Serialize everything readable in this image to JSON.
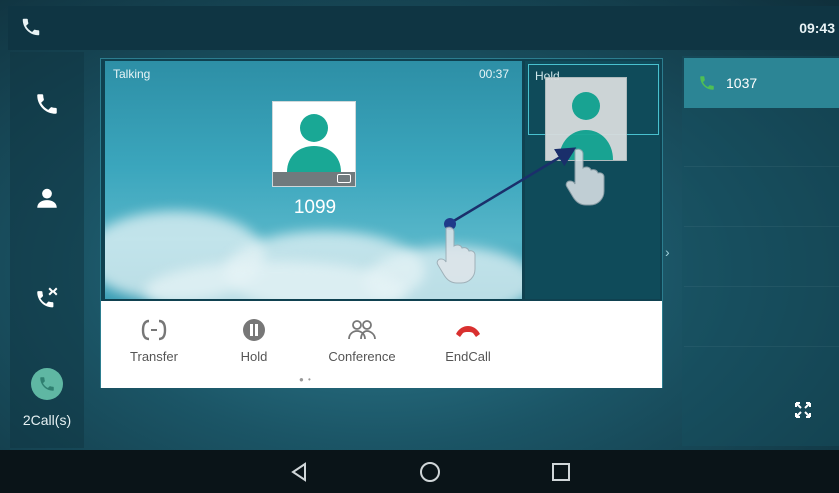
{
  "status_bar": {
    "time": "09:43",
    "icon": "phone-icon"
  },
  "sidebar": {
    "items": [
      {
        "icon": "phone-icon"
      },
      {
        "icon": "contacts-icon"
      },
      {
        "icon": "call-history-icon"
      }
    ],
    "calls_icon": "active-call-icon",
    "calls_label": "2Call(s)"
  },
  "main": {
    "talking": {
      "label": "Talking",
      "timer": "00:37",
      "caller_number": "1099"
    },
    "hold": {
      "label": "Hold"
    },
    "actions": [
      {
        "label": "Transfer",
        "icon": "transfer-icon"
      },
      {
        "label": "Hold",
        "icon": "hold-icon"
      },
      {
        "label": "Conference",
        "icon": "conference-icon"
      },
      {
        "label": "EndCall",
        "icon": "end-call-icon",
        "color": "#d9302f"
      }
    ]
  },
  "right_panel": {
    "call_number": "1037",
    "call_icon_color": "#4fbf54"
  },
  "colors": {
    "accent": "#2c8595",
    "teal": "#1aa69a",
    "end_call": "#d9302f"
  }
}
